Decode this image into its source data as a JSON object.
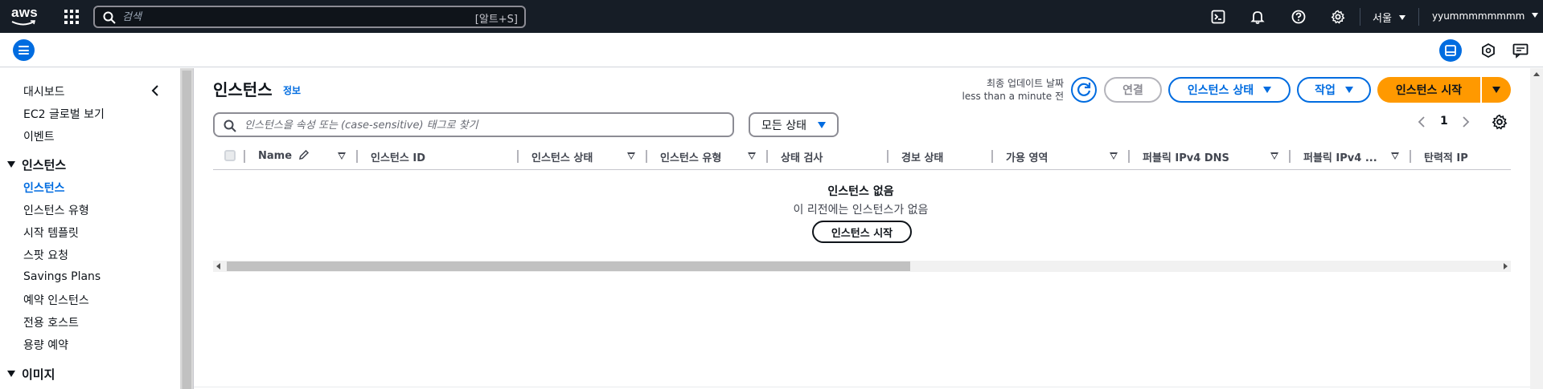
{
  "topnav": {
    "logo_text": "aws",
    "search_placeholder": "검색",
    "search_shortcut": "[알트+S]",
    "region": "서울",
    "account": "yyummmmmmmm",
    "icons": [
      "cloudshell-icon",
      "bell-icon",
      "help-icon",
      "gear-icon"
    ]
  },
  "sidebar": {
    "items_top": [
      {
        "label": "대시보드"
      },
      {
        "label": "EC2 글로벌 보기"
      },
      {
        "label": "이벤트"
      }
    ],
    "section_instances": "인스턴스",
    "instance_items": [
      {
        "label": "인스턴스",
        "active": true
      },
      {
        "label": "인스턴스 유형"
      },
      {
        "label": "시작 템플릿"
      },
      {
        "label": "스팟 요청"
      },
      {
        "label": "Savings Plans"
      },
      {
        "label": "예약 인스턴스"
      },
      {
        "label": "전용 호스트"
      },
      {
        "label": "용량 예약"
      }
    ],
    "section_images": "이미지"
  },
  "main": {
    "title": "인스턴스",
    "info": "정보",
    "last_update_label": "최종 업데이트 날짜",
    "last_update_value": "less than a minute 전",
    "connect_label": "연결",
    "instance_state_label": "인스턴스 상태",
    "actions_label": "작업",
    "launch_label": "인스턴스 시작",
    "filter_placeholder": "인스턴스을 속성 또는 (case-sensitive) 태그로 찾기",
    "state_filter": "모든 상태",
    "page_number": "1",
    "columns": [
      "Name",
      "인스턴스 ID",
      "인스턴스 상태",
      "인스턴스 유형",
      "상태 검사",
      "경보 상태",
      "가용 영역",
      "퍼블릭 IPv4 DNS",
      "퍼블릭 IPv4 ...",
      "탄력적 IP"
    ],
    "empty_title": "인스턴스 없음",
    "empty_subtitle": "이 리전에는 인스턴스가 없음",
    "empty_button": "인스턴스 시작"
  },
  "colors": {
    "nav_bg": "#161d26",
    "accent": "#006ce0",
    "primary_button": "#ff9900"
  }
}
